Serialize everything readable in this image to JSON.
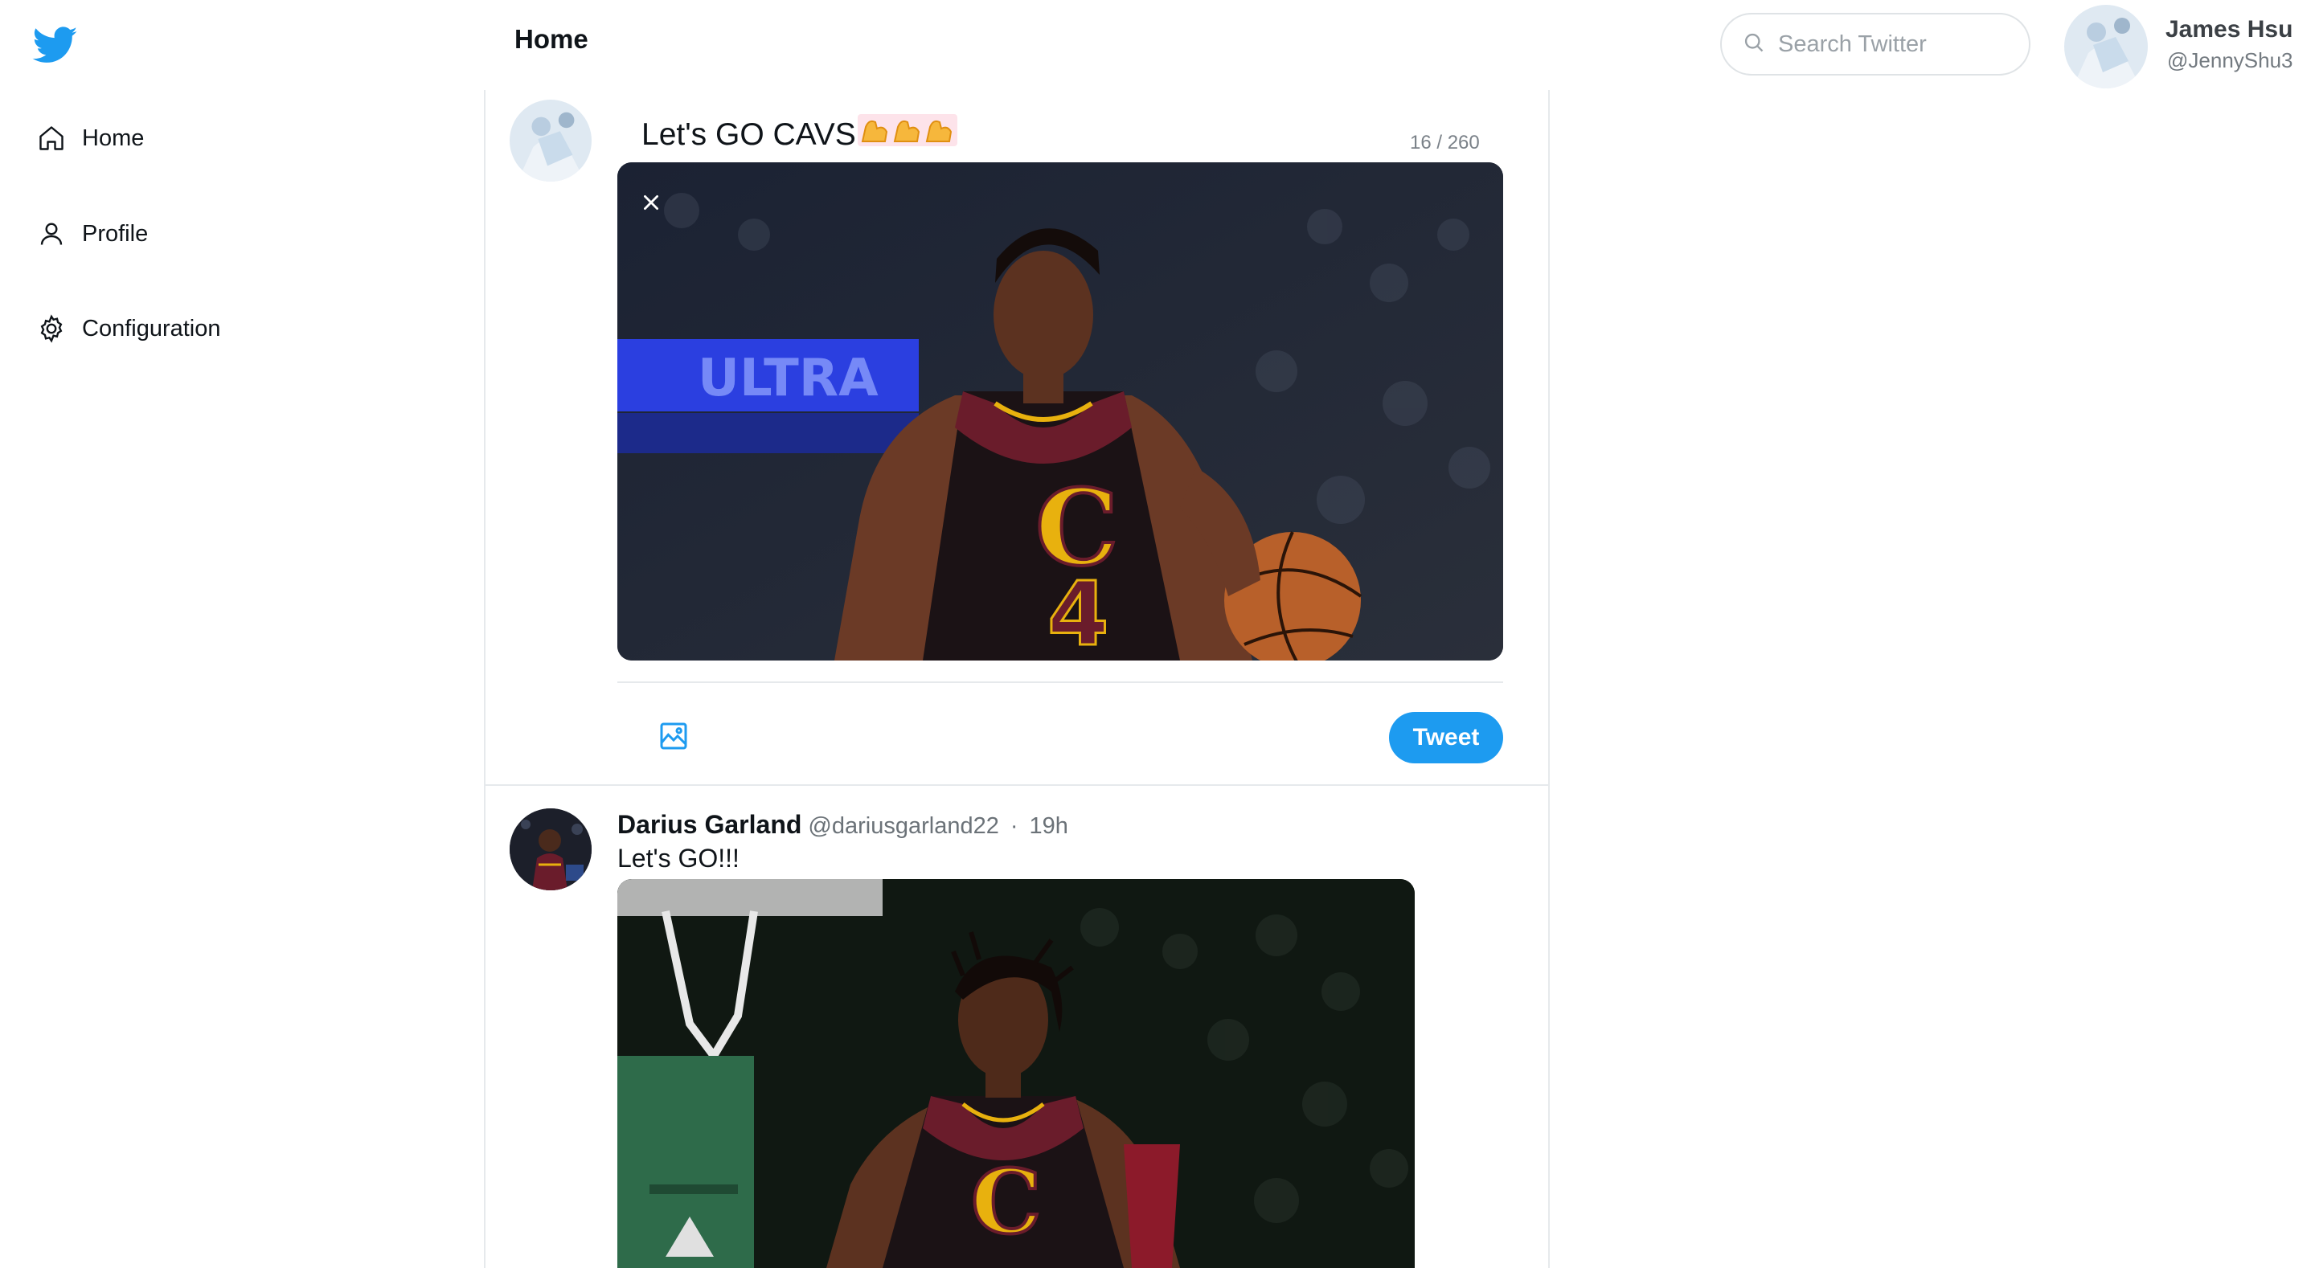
{
  "header": {
    "page_title": "Home"
  },
  "nav": {
    "items": [
      {
        "label": "Home",
        "icon": "home-icon"
      },
      {
        "label": "Profile",
        "icon": "user-icon"
      },
      {
        "label": "Configuration",
        "icon": "gear-icon"
      }
    ]
  },
  "search": {
    "placeholder": "Search Twitter",
    "value": ""
  },
  "current_user": {
    "name": "James Hsu",
    "handle": "@JennyShu3"
  },
  "composer": {
    "text": "Let's GO CAVS",
    "emoji": "flexed-biceps x3",
    "char_count": "16 / 260",
    "tweet_button_label": "Tweet",
    "attachment": "basketball player dribbling in wine Cavaliers jersey number 4"
  },
  "tweets": [
    {
      "name": "Darius Garland",
      "handle": "@dariusgarland22",
      "separator": "·",
      "time": "19h",
      "text": "Let's GO!!!",
      "media": "basketball player in wine Cavaliers jersey"
    }
  ],
  "colors": {
    "accent": "#1d9bf0",
    "brand": "#1d9bf0",
    "jersey": "#5a1a24",
    "jersey_gold": "#e8b10e"
  }
}
